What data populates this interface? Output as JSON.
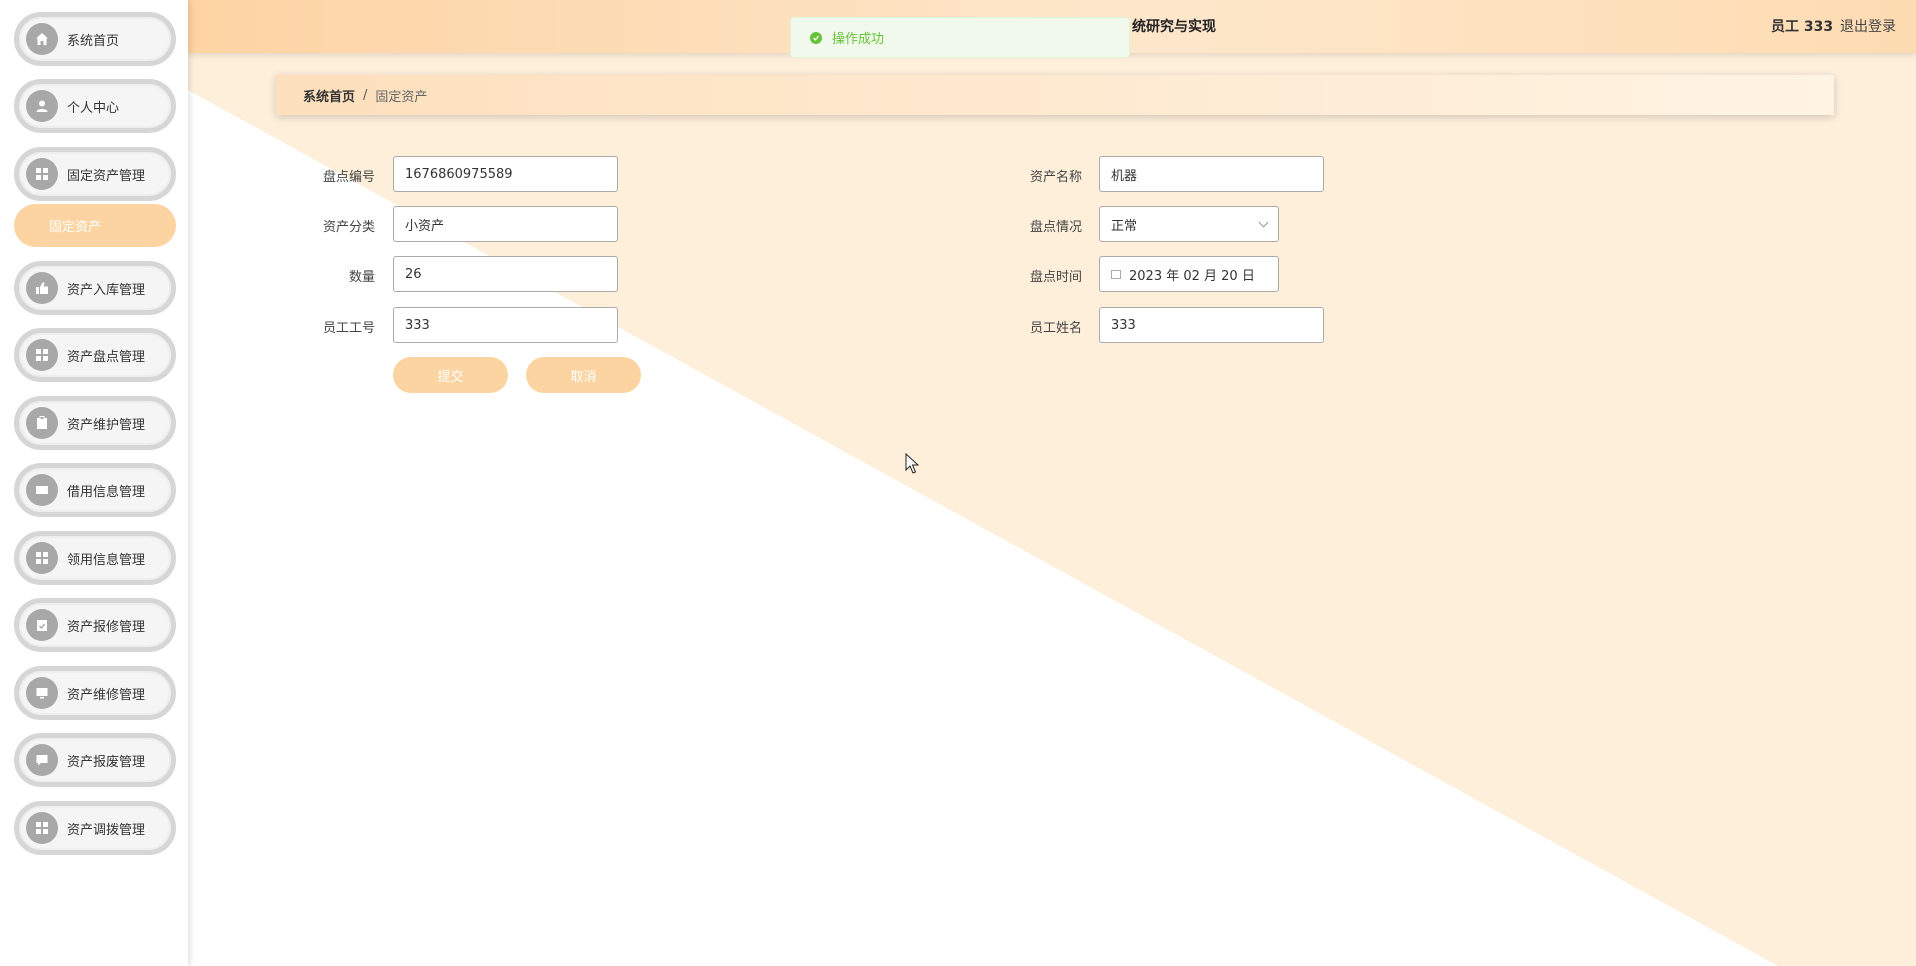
{
  "sidebar": {
    "items": [
      {
        "label": "系统首页",
        "icon": "home-icon"
      },
      {
        "label": "个人中心",
        "icon": "user-icon"
      },
      {
        "label": "固定资产管理",
        "icon": "grid-icon"
      },
      {
        "label": "资产入库管理",
        "icon": "thumb-icon"
      },
      {
        "label": "资产盘点管理",
        "icon": "grid-icon"
      },
      {
        "label": "资产维护管理",
        "icon": "clipboard-icon"
      },
      {
        "label": "借用信息管理",
        "icon": "ticket-icon"
      },
      {
        "label": "领用信息管理",
        "icon": "grid-icon"
      },
      {
        "label": "资产报修管理",
        "icon": "clipboard-check-icon"
      },
      {
        "label": "资产维修管理",
        "icon": "monitor-icon"
      },
      {
        "label": "资产报废管理",
        "icon": "chat-icon"
      },
      {
        "label": "资产调拨管理",
        "icon": "grid-icon"
      }
    ],
    "submenu_label": "固定资产"
  },
  "header": {
    "title": "统研究与实现",
    "user": "员工 333",
    "logout": "退出登录"
  },
  "toast": {
    "message": "操作成功"
  },
  "breadcrumb": {
    "home": "系统首页",
    "separator": "/",
    "current": "固定资产"
  },
  "form": {
    "inventory_no_label": "盘点编号",
    "inventory_no": "1676860975589",
    "asset_name_label": "资产名称",
    "asset_name": "机器",
    "asset_category_label": "资产分类",
    "asset_category": "小资产",
    "inventory_status_label": "盘点情况",
    "inventory_status": "正常",
    "quantity_label": "数量",
    "quantity": "26",
    "inventory_time_label": "盘点时间",
    "inventory_time": "2023 年 02 月 20 日",
    "employee_no_label": "员工工号",
    "employee_no": "333",
    "employee_name_label": "员工姓名",
    "employee_name": "333",
    "submit": "提交",
    "cancel": "取消"
  },
  "colors": {
    "accent": "#fcd4a2",
    "header": "#fdd3a3",
    "success": "#67c23a"
  }
}
